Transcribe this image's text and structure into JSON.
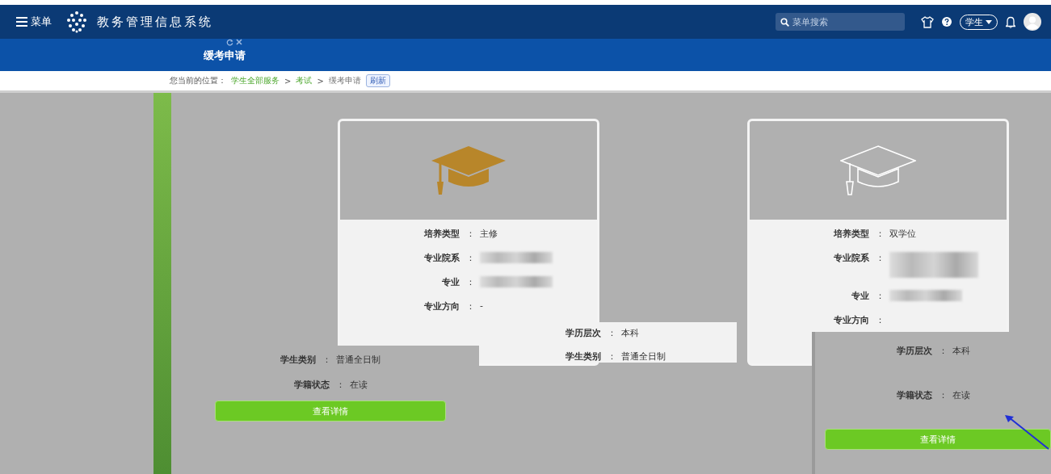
{
  "header": {
    "menu_label": "菜单",
    "system_title": "教务管理信息系统",
    "search": {
      "placeholder": "菜单搜索"
    },
    "role": "学生"
  },
  "tabs": [
    {
      "label": "缓考申请",
      "selected": true
    }
  ],
  "breadcrumb": {
    "prefix": "您当前的位置：",
    "items": [
      "学生全部服务",
      "考试",
      "缓考申请"
    ],
    "separator": ">",
    "refresh": "刷新"
  },
  "field_separator": "：",
  "cards": [
    {
      "kind": "filled",
      "fields": [
        {
          "label": "培养类型",
          "value": "主修"
        },
        {
          "label": "专业院系",
          "redacted": true
        },
        {
          "label": "专业",
          "redacted": true
        },
        {
          "label": "专业方向",
          "value": "-"
        }
      ]
    },
    {
      "kind": "outline",
      "fields": [
        {
          "label": "培养类型",
          "value": "双学位"
        },
        {
          "label": "专业院系",
          "redacted": true,
          "wrap": true
        },
        {
          "label": "专业",
          "redacted": true
        },
        {
          "label": "专业方向"
        }
      ]
    }
  ],
  "fragments": [
    {
      "kind": "panel",
      "fields": [
        {
          "label": "学生类别",
          "value": "普通全日制"
        },
        {
          "label": "学籍状态",
          "value": "在读"
        }
      ],
      "button": "查看详情"
    },
    {
      "kind": "strip",
      "fields": [
        {
          "label": "学历层次",
          "value": "本科"
        },
        {
          "label": "学生类别",
          "value": "普通全日制"
        }
      ]
    },
    {
      "kind": "panel-right",
      "fields": [
        {
          "label": "学历层次",
          "value": "本科"
        },
        {
          "label": "学籍状态",
          "value": "在读"
        }
      ],
      "button": "查看详情"
    }
  ]
}
